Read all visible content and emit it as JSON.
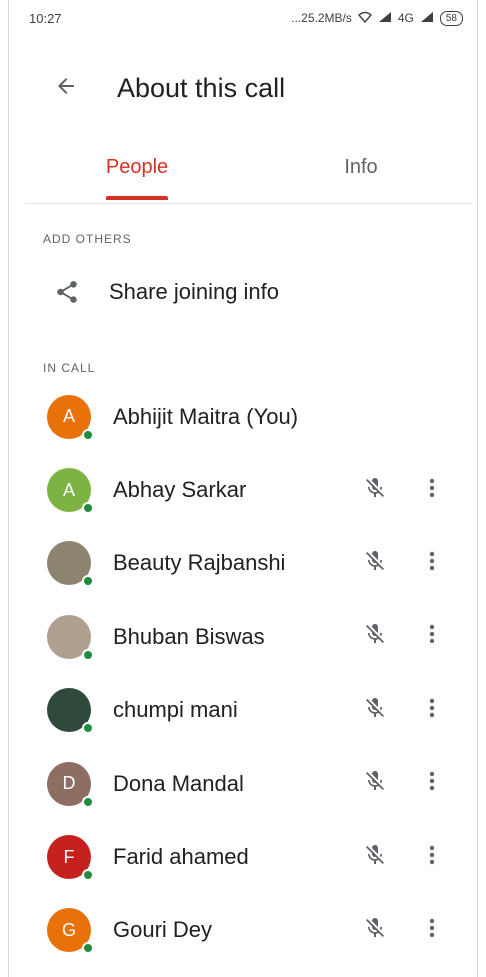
{
  "status_bar": {
    "time": "10:27",
    "network_speed": "...25.2MB/s",
    "signal": "4G",
    "battery": "58"
  },
  "app_bar": {
    "title": "About this call",
    "back_icon": "arrow-left-icon"
  },
  "tabs": [
    {
      "label": "People",
      "active": true
    },
    {
      "label": "Info",
      "active": false
    }
  ],
  "add_others": {
    "section_label": "ADD OTHERS",
    "share_label": "Share joining info",
    "share_icon": "share-icon"
  },
  "in_call": {
    "section_label": "IN CALL",
    "people": [
      {
        "name": "Abhijit Maitra (You)",
        "initial": "A",
        "avatar_color": "#e8710a",
        "muted": false,
        "self": true
      },
      {
        "name": "Abhay Sarkar",
        "initial": "A",
        "avatar_color": "#7cb342",
        "muted": true,
        "self": false
      },
      {
        "name": "Beauty Rajbanshi",
        "initial": "",
        "avatar_color": "#8d8470",
        "muted": true,
        "self": false
      },
      {
        "name": "Bhuban Biswas",
        "initial": "",
        "avatar_color": "#b0a090",
        "muted": true,
        "self": false
      },
      {
        "name": "chumpi mani",
        "initial": "",
        "avatar_color": "#2f4a3a",
        "muted": true,
        "self": false
      },
      {
        "name": "Dona Mandal",
        "initial": "D",
        "avatar_color": "#8d6e63",
        "muted": true,
        "self": false
      },
      {
        "name": "Farid ahamed",
        "initial": "F",
        "avatar_color": "#c5221f",
        "muted": true,
        "self": false
      },
      {
        "name": "Gouri Dey",
        "initial": "G",
        "avatar_color": "#e8710a",
        "muted": true,
        "self": false
      }
    ]
  },
  "colors": {
    "accent": "#d93025",
    "presence": "#1e8e3e"
  }
}
